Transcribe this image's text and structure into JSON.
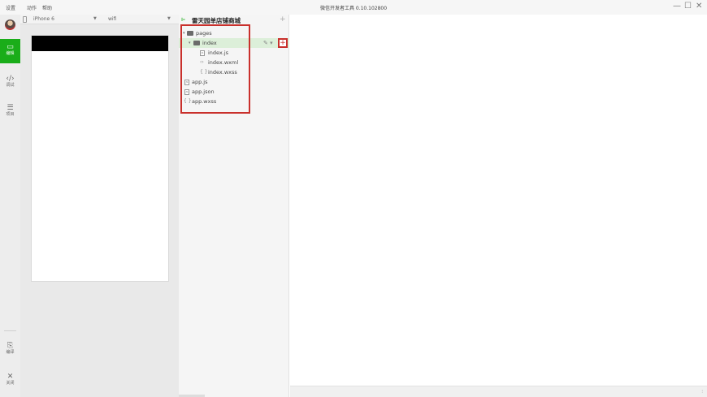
{
  "menu": {
    "items": [
      "设置",
      "动作",
      "帮助"
    ]
  },
  "app_title": "微信开发者工具 0.10.102800",
  "window_controls": {
    "minimize": "—",
    "maximize": "☐",
    "close": "✕"
  },
  "sidebar": {
    "buttons": [
      {
        "icon": "▭",
        "label": "编辑",
        "icon_name": "edit-icon",
        "active": true
      },
      {
        "icon": "‹/›",
        "label": "调试",
        "icon_name": "debug-icon",
        "active": false
      },
      {
        "icon": "☰",
        "label": "项目",
        "icon_name": "project-icon",
        "active": false
      },
      {
        "icon": "⎘",
        "label": "编译",
        "icon_name": "compile-icon",
        "active": false
      },
      {
        "icon": "✕",
        "label": "关闭",
        "icon_name": "close-icon",
        "active": false
      }
    ]
  },
  "simulator": {
    "device": "iPhone 6",
    "network": "wifi"
  },
  "files": {
    "project_name": "雷天园单店铺商城",
    "add_symbol": "+",
    "tree": [
      {
        "name": "pages",
        "type": "folder"
      },
      {
        "name": "index",
        "type": "folder"
      },
      {
        "name": "index.js",
        "type": "js"
      },
      {
        "name": "index.wxml",
        "type": "wxml"
      },
      {
        "name": "index.wxss",
        "type": "wxss"
      },
      {
        "name": "app.js",
        "type": "js"
      },
      {
        "name": "app.json",
        "type": "json"
      },
      {
        "name": "app.wxss",
        "type": "wxss"
      }
    ],
    "row_actions": "✎ ▾",
    "add_file_symbol": "+"
  },
  "status": {
    "indicator": "⁝"
  },
  "colors": {
    "accent": "#1aad19",
    "highlight": "#c9302c"
  }
}
